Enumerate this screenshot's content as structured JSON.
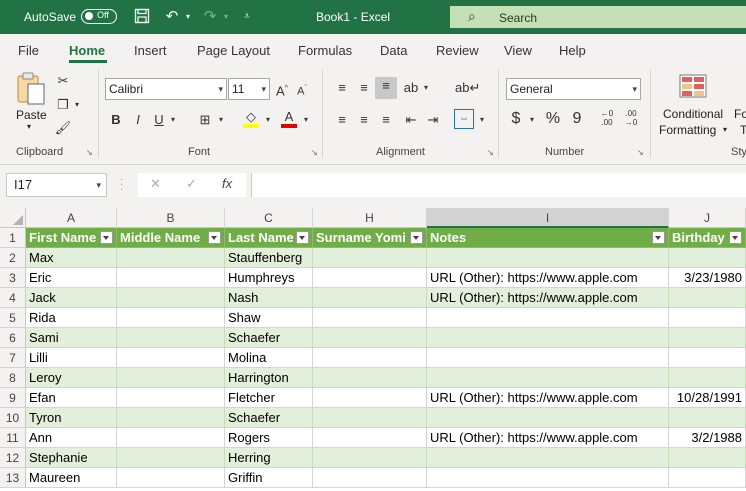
{
  "titlebar": {
    "autosave_label": "AutoSave",
    "toggle_state": "Off",
    "title": "Book1  -  Excel",
    "search_placeholder": "Search"
  },
  "menu": [
    "File",
    "Home",
    "Insert",
    "Page Layout",
    "Formulas",
    "Data",
    "Review",
    "View",
    "Help"
  ],
  "active_tab": "Home",
  "ribbon": {
    "clipboard": {
      "label": "Clipboard",
      "paste": "Paste"
    },
    "font": {
      "label": "Font",
      "name": "Calibri",
      "size": "11",
      "bold": "B",
      "italic": "I",
      "underline": "U"
    },
    "alignment": {
      "label": "Alignment"
    },
    "number": {
      "label": "Number",
      "format": "General"
    },
    "styles": {
      "label": "Sty",
      "conditional_1": "Conditional",
      "conditional_2": "Formatting",
      "fo": "Fo",
      "t": "T"
    }
  },
  "formula_bar": {
    "name_box": "I17",
    "fx": "fx",
    "value": ""
  },
  "columns": [
    {
      "letter": "A",
      "w": 91
    },
    {
      "letter": "B",
      "w": 108
    },
    {
      "letter": "C",
      "w": 88
    },
    {
      "letter": "H",
      "w": 114
    },
    {
      "letter": "I",
      "w": 242
    },
    {
      "letter": "J",
      "w": 77
    }
  ],
  "selected_column": "I",
  "header_row": [
    "First Name",
    "Middle Name",
    "Last Name",
    "Surname Yomi",
    "Notes",
    "Birthday"
  ],
  "rows": [
    {
      "n": "2",
      "cells": [
        "Max",
        "",
        "Stauffenberg",
        "",
        "",
        ""
      ]
    },
    {
      "n": "3",
      "cells": [
        "Eric",
        "",
        "Humphreys",
        "",
        "URL (Other): https://www.apple.com",
        "3/23/1980"
      ]
    },
    {
      "n": "4",
      "cells": [
        "Jack",
        "",
        "Nash",
        "",
        "URL (Other): https://www.apple.com",
        ""
      ]
    },
    {
      "n": "5",
      "cells": [
        "Rida",
        "",
        "Shaw",
        "",
        "",
        ""
      ]
    },
    {
      "n": "6",
      "cells": [
        "Sami",
        "",
        "Schaefer",
        "",
        "",
        ""
      ]
    },
    {
      "n": "7",
      "cells": [
        "Lilli",
        "",
        "Molina",
        "",
        "",
        ""
      ]
    },
    {
      "n": "8",
      "cells": [
        "Leroy",
        "",
        "Harrington",
        "",
        "",
        ""
      ]
    },
    {
      "n": "9",
      "cells": [
        "Efan",
        "",
        "Fletcher",
        "",
        "URL (Other): https://www.apple.com",
        "10/28/1991"
      ]
    },
    {
      "n": "10",
      "cells": [
        "Tyron",
        "",
        "Schaefer",
        "",
        "",
        ""
      ]
    },
    {
      "n": "11",
      "cells": [
        "Ann",
        "",
        "Rogers",
        "",
        "URL (Other): https://www.apple.com",
        "3/2/1988"
      ]
    },
    {
      "n": "12",
      "cells": [
        "Stephanie",
        "",
        "Herring",
        "",
        "",
        ""
      ]
    },
    {
      "n": "13",
      "cells": [
        "Maureen",
        "",
        "Griffin",
        "",
        "",
        ""
      ]
    }
  ],
  "colors": {
    "excel_green": "#217346",
    "table_header": "#70ad47",
    "table_band": "#e2efda"
  }
}
